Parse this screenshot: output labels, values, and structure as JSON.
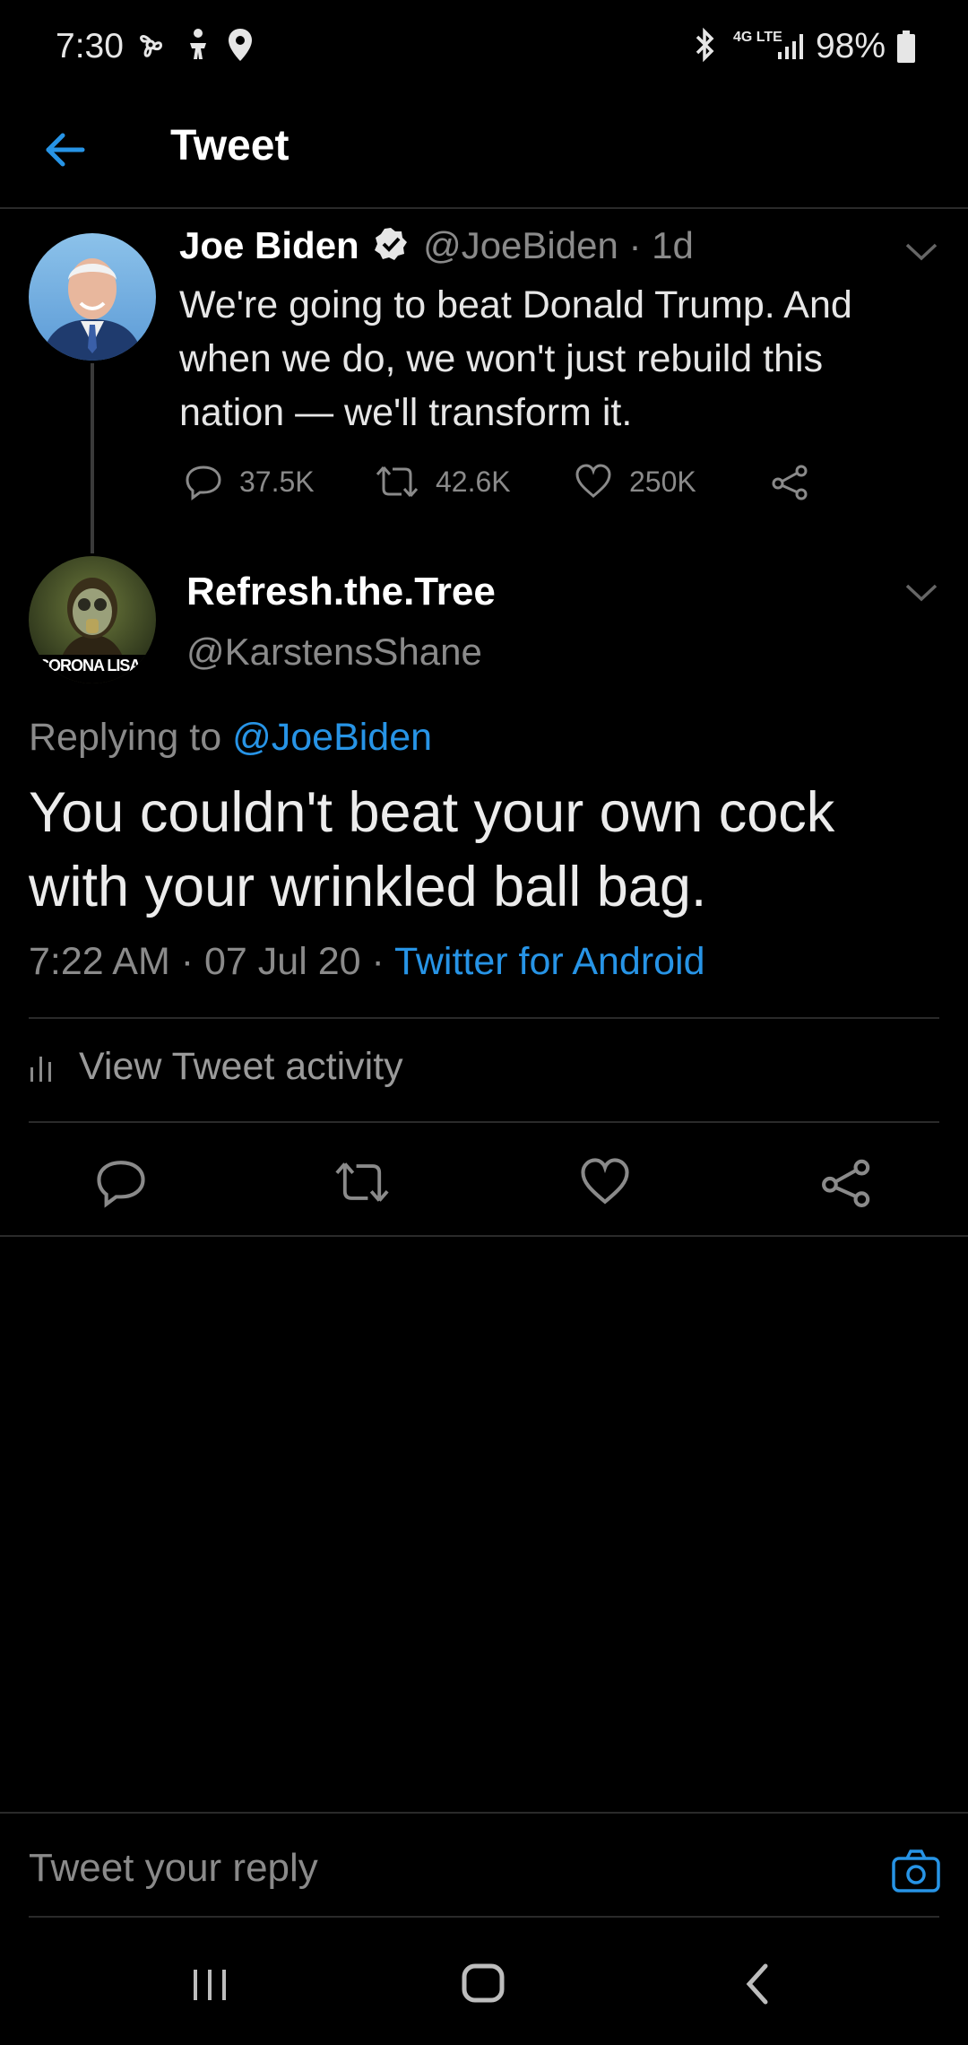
{
  "status_bar": {
    "time": "7:30",
    "network": "4G LTE",
    "battery": "98%"
  },
  "header": {
    "title": "Tweet"
  },
  "parent_tweet": {
    "name": "Joe Biden",
    "handle": "@JoeBiden",
    "age": "· 1d",
    "text": "We're going to beat Donald Trump. And when we do, we won't just rebuild this nation — we'll transform it.",
    "replies": "37.5K",
    "retweets": "42.6K",
    "likes": "250K"
  },
  "reply_tweet": {
    "name": "Refresh.the.Tree",
    "handle": "@KarstensShane",
    "avatar_caption": "CORONA LISA",
    "replying_prefix": "Replying to",
    "replying_to": "@JoeBiden",
    "text": "You couldn't beat your own cock with your wrinkled ball bag.",
    "time": "7:22 AM",
    "date": "07 Jul 20",
    "source": "Twitter for Android"
  },
  "activity_label": "View Tweet activity",
  "reply_placeholder": "Tweet your reply",
  "colors": {
    "accent": "#2794e6",
    "background": "#000000",
    "muted": "#8a8a8a"
  },
  "icons": [
    "back-arrow-icon",
    "verified-icon",
    "chevron-down-icon",
    "reply-icon",
    "retweet-icon",
    "like-icon",
    "share-icon",
    "bar-chart-icon",
    "camera-icon"
  ]
}
